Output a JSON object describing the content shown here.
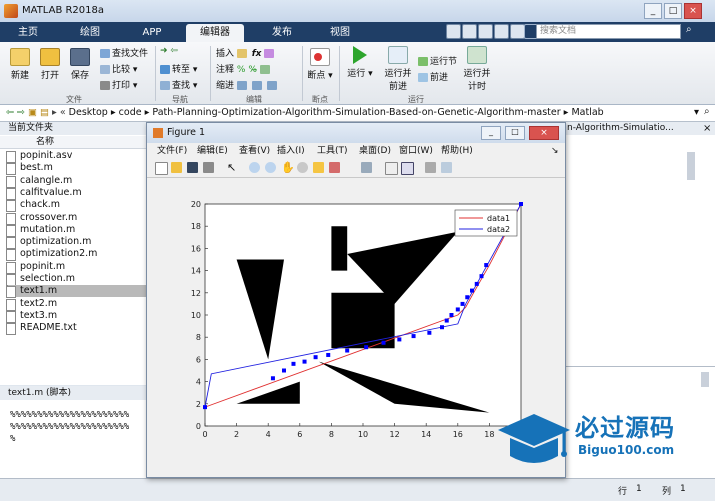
{
  "window": {
    "title": "MATLAB R2018a",
    "min": "_",
    "max": "□",
    "close": "×"
  },
  "tabs": [
    "主页",
    "绘图",
    "APP",
    "编辑器",
    "发布",
    "视图"
  ],
  "search_placeholder": "搜索文档",
  "ribbon": {
    "file": {
      "new": "新建",
      "open": "打开",
      "save": "保存",
      "find_files": "查找文件",
      "compare": "比较",
      "print": "打印",
      "group": "文件"
    },
    "nav": {
      "goto": "转至",
      "find": "查找",
      "group": "导航"
    },
    "edit": {
      "insert": "插入",
      "comment": "注释",
      "indent": "缩进",
      "group": "编辑"
    },
    "breakpoint": {
      "label": "断点",
      "group": "断点"
    },
    "run": {
      "run": "运行",
      "run_advance_1": "运行并",
      "run_advance_2": "前进",
      "run_section": "运行节",
      "advance": "前进",
      "run_time_1": "运行并",
      "run_time_2": "计时",
      "group": "运行"
    }
  },
  "path": [
    "Desktop",
    "code",
    "Path-Planning-Optimization-Algorithm-Simulation-Based-on-Genetic-Algorithm-master",
    "Matlab"
  ],
  "current_folder": {
    "title": "当前文件夹",
    "header": "名称",
    "files": [
      "popinit.asv",
      "best.m",
      "calangle.m",
      "calfitvalue.m",
      "chack.m",
      "crossover.m",
      "mutation.m",
      "optimization.m",
      "optimization2.m",
      "popinit.m",
      "selection.m",
      "text1.m",
      "text2.m",
      "text3.m",
      "README.txt"
    ],
    "selected": "text1.m"
  },
  "details": {
    "title": "text1.m  (脚本)",
    "lines": [
      "%%%%%%%%%%%%%%%%%%%%%%",
      "%%%%%%%%%%%%%%%%%%%%%%",
      "%"
    ]
  },
  "editor_tab_fragment": "n-Algorithm-Simulatio...",
  "status": {
    "row_label": "行",
    "row": "1",
    "col_label": "列",
    "col": "1"
  },
  "figure": {
    "title": "Figure 1",
    "menu": [
      "文件(F)",
      "编辑(E)",
      "查看(V)",
      "插入(I)",
      "工具(T)",
      "桌面(D)",
      "窗口(W)",
      "帮助(H)"
    ]
  },
  "chart_data": {
    "type": "line",
    "xlim": [
      0,
      20
    ],
    "ylim": [
      0,
      20
    ],
    "xticks": [
      0,
      2,
      4,
      6,
      8,
      10,
      12,
      14,
      16,
      18,
      20
    ],
    "yticks": [
      0,
      2,
      4,
      6,
      8,
      10,
      12,
      14,
      16,
      18,
      20
    ],
    "grid": false,
    "legend_position": "top-right",
    "series": [
      {
        "name": "data1",
        "color": "#e03030",
        "x": [
          0,
          16,
          16.5,
          17,
          18,
          20
        ],
        "y": [
          1.7,
          10,
          10.7,
          12,
          14.5,
          20
        ]
      },
      {
        "name": "data2",
        "color": "#2020e0",
        "x": [
          0,
          0.4,
          16,
          16.5,
          20
        ],
        "y": [
          1.7,
          4.7,
          9.2,
          11,
          20
        ]
      },
      {
        "name": "",
        "color": "#0000ff",
        "markers_only": true,
        "x": [
          0,
          4.3,
          5.0,
          5.6,
          6.3,
          7.0,
          7.8,
          9.0,
          10.2,
          11.3,
          12.3,
          13.2,
          14.2,
          15.0,
          15.3,
          15.6,
          16.0,
          16.3,
          16.6,
          16.9,
          17.2,
          17.5,
          17.8,
          20
        ],
        "y": [
          1.7,
          4.3,
          5.0,
          5.6,
          5.8,
          6.2,
          6.4,
          6.8,
          7.1,
          7.5,
          7.8,
          8.1,
          8.4,
          8.9,
          9.5,
          10.0,
          10.5,
          11.0,
          11.6,
          12.2,
          12.8,
          13.5,
          14.5,
          20
        ]
      }
    ],
    "obstacles": [
      [
        [
          2,
          15
        ],
        [
          5,
          15
        ],
        [
          4,
          6
        ]
      ],
      [
        [
          8,
          18
        ],
        [
          9,
          18
        ],
        [
          9,
          14
        ],
        [
          8,
          14
        ]
      ],
      [
        [
          9,
          15.5
        ],
        [
          16,
          17.5
        ],
        [
          12,
          11
        ]
      ],
      [
        [
          8,
          12
        ],
        [
          12,
          12
        ],
        [
          12,
          7
        ],
        [
          8,
          7
        ]
      ],
      [
        [
          2,
          2
        ],
        [
          6,
          2
        ],
        [
          6,
          4
        ]
      ],
      [
        [
          7.2,
          5.8
        ],
        [
          18,
          1.2
        ],
        [
          12,
          2
        ]
      ]
    ]
  }
}
